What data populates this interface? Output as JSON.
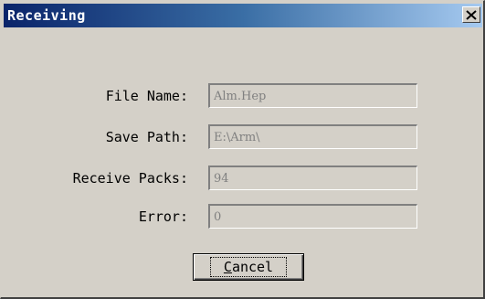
{
  "window": {
    "title": "Receiving",
    "close_icon": "close-icon"
  },
  "fields": [
    {
      "label": "File Name:",
      "value": "Alm.Hep"
    },
    {
      "label": "Save Path:",
      "value": "E:\\Arm\\"
    },
    {
      "label": "Receive Packs:",
      "value": "94"
    },
    {
      "label": "Error:",
      "value": "0"
    }
  ],
  "buttons": {
    "cancel_first": "C",
    "cancel_rest": "ancel"
  }
}
